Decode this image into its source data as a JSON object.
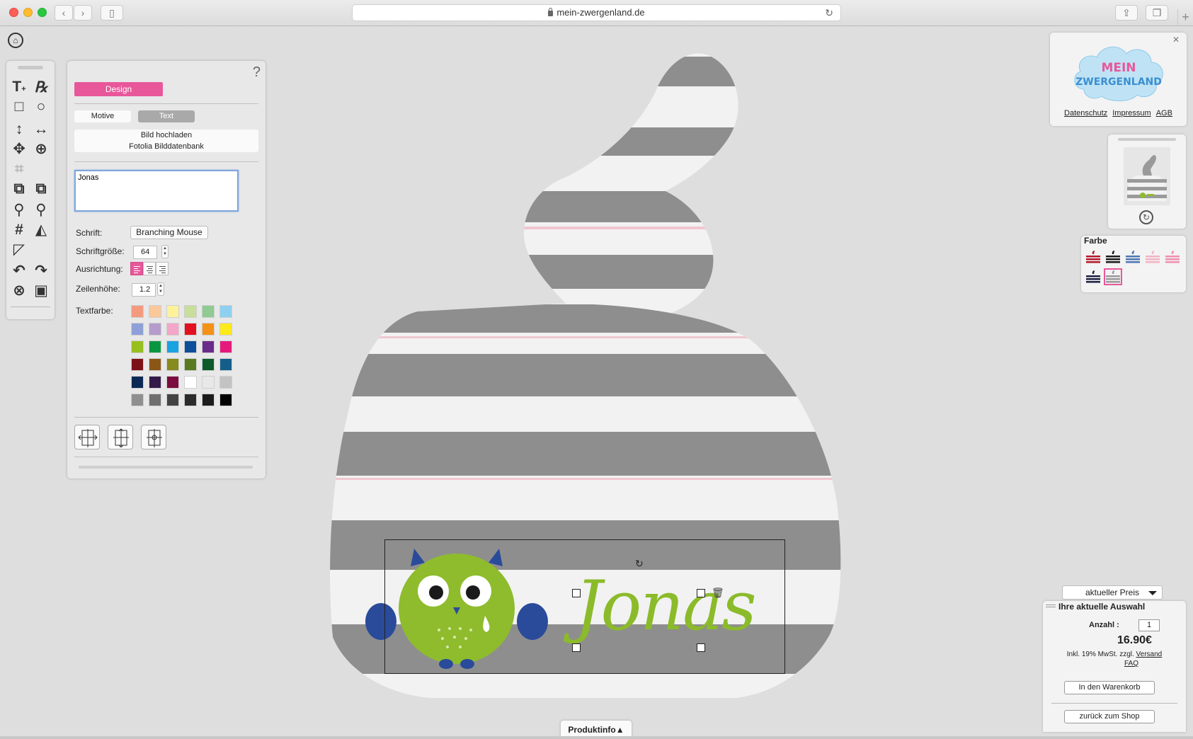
{
  "browser": {
    "url": "mein-zwergenland.de"
  },
  "panel": {
    "help": "?",
    "design_label": "Design",
    "tab_motive": "Motive",
    "tab_text": "Text",
    "upload_image": "Bild hochladen",
    "fotolia": "Fotolia Bilddatenbank",
    "text_value": "Jonas",
    "font_label": "Schrift:",
    "font_value": "Branching Mouse",
    "fontsize_label": "Schriftgröße:",
    "fontsize_value": "64",
    "align_label": "Ausrichtung:",
    "lineheight_label": "Zeilenhöhe:",
    "lineheight_value": "1.2",
    "textcolor_label": "Textfarbe:",
    "swatches": [
      "#f39a7f",
      "#fbc89a",
      "#fdf29a",
      "#c8de9a",
      "#8fcb93",
      "#8fd0f0",
      "#8fa0d8",
      "#b59ccc",
      "#f4a6c8",
      "#e3101f",
      "#f39216",
      "#fdea1b",
      "#97bf1e",
      "#0a9641",
      "#1ba2e0",
      "#0e4d9a",
      "#6a2c8a",
      "#e5197c",
      "#7c1217",
      "#8a5717",
      "#878a1f",
      "#5a7a1f",
      "#0d5a2b",
      "#145f8a",
      "#0c2956",
      "#341a4a",
      "#7a0c3f",
      "#ffffff",
      "#e8e8e8",
      "#c3c3c3",
      "#8f8f8f",
      "#6f6f6f",
      "#434343",
      "#2b2b2b",
      "#1c1c1c",
      "#000000"
    ]
  },
  "canvas": {
    "design_text": "Jonas"
  },
  "logo": {
    "line1": "MEIN",
    "line2": "ZWERGENLAND",
    "links": [
      "Datenschutz",
      "Impressum",
      "AGB"
    ]
  },
  "farbe": {
    "title": "Farbe",
    "caps": [
      {
        "stripe": "#b3182b"
      },
      {
        "stripe": "#1a1a1a"
      },
      {
        "stripe": "#4e76b3"
      },
      {
        "stripe": "#f2b3c5"
      },
      {
        "stripe": "#ee8fb0"
      },
      {
        "stripe": "#1b2140"
      },
      {
        "stripe": "#9a9a9a"
      }
    ]
  },
  "order": {
    "price_dropdown": "aktueller Preis",
    "title": "Ihre aktuelle Auswahl",
    "qty_label": "Anzahl :",
    "qty_value": "1",
    "price": "16.90€",
    "vat_text": "Inkl. 19% MwSt. zzgl.",
    "shipping_link": "Versand",
    "faq_link": "FAQ",
    "cart_button": "In den Warenkorb",
    "shop_button": "zurück zum Shop"
  },
  "produktinfo": "Produktinfo"
}
